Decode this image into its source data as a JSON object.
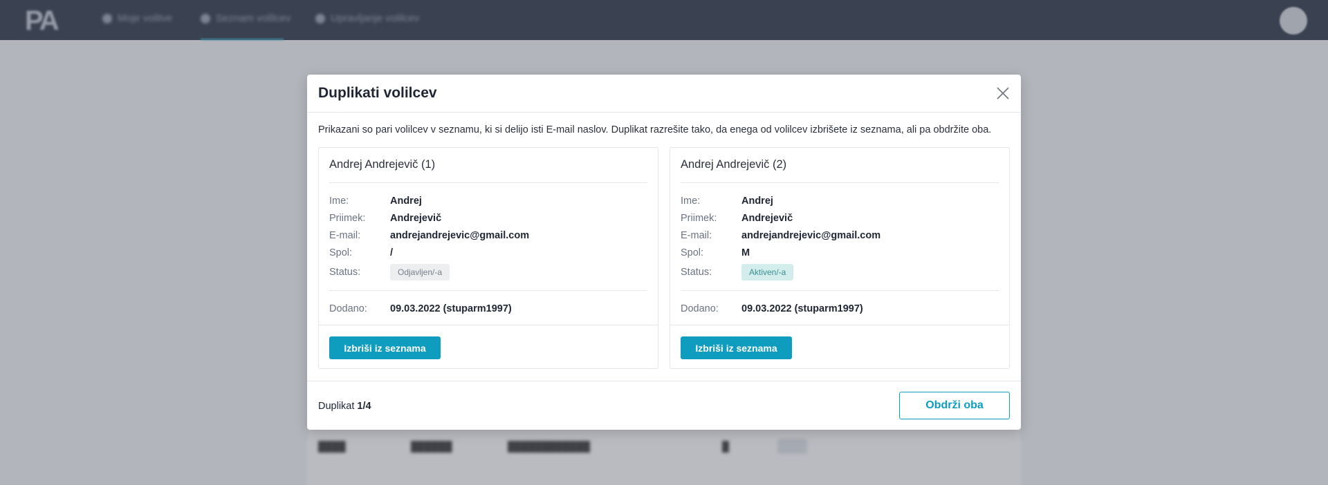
{
  "app": {
    "logo_text": "PA",
    "nav": [
      {
        "label": "Moje volitve"
      },
      {
        "label": "Seznam volilcev"
      },
      {
        "label": "Upravljanje volilcev"
      }
    ]
  },
  "modal": {
    "title": "Duplikati volilcev",
    "close_icon": "close-icon",
    "intro": "Prikazani so pari volilcev v seznamu, ki si delijo isti E-mail naslov. Duplikat razrešite tako, da enega od volilcev izbrišete iz seznama, ali pa obdržite oba.",
    "labels": {
      "ime": "Ime:",
      "priimek": "Priimek:",
      "email": "E-mail:",
      "spol": "Spol:",
      "status": "Status:",
      "dodano": "Dodano:"
    },
    "cards": [
      {
        "title": "Andrej Andrejevič (1)",
        "ime": "Andrej",
        "priimek": "Andrejevič",
        "email": "andrejandrejevic@gmail.com",
        "spol": "/",
        "status": "Odjavljen/-a",
        "dodano": "09.03.2022 (stuparm1997)",
        "delete_label": "Izbriši iz seznama"
      },
      {
        "title": "Andrej Andrejevič (2)",
        "ime": "Andrej",
        "priimek": "Andrejevič",
        "email": "andrejandrejevic@gmail.com",
        "spol": "M",
        "status": "Aktiven/-a",
        "dodano": "09.03.2022 (stuparm1997)",
        "delete_label": "Izbriši iz seznama"
      }
    ],
    "footer": {
      "counter_prefix": "Duplikat",
      "counter_value": "1/4",
      "keep_both_label": "Obdrži oba"
    }
  },
  "colors": {
    "accent": "#0f9dbf",
    "topbar": "#2c3647",
    "status_active_bg": "#d3ecec",
    "status_inactive_bg": "#eceef0"
  }
}
